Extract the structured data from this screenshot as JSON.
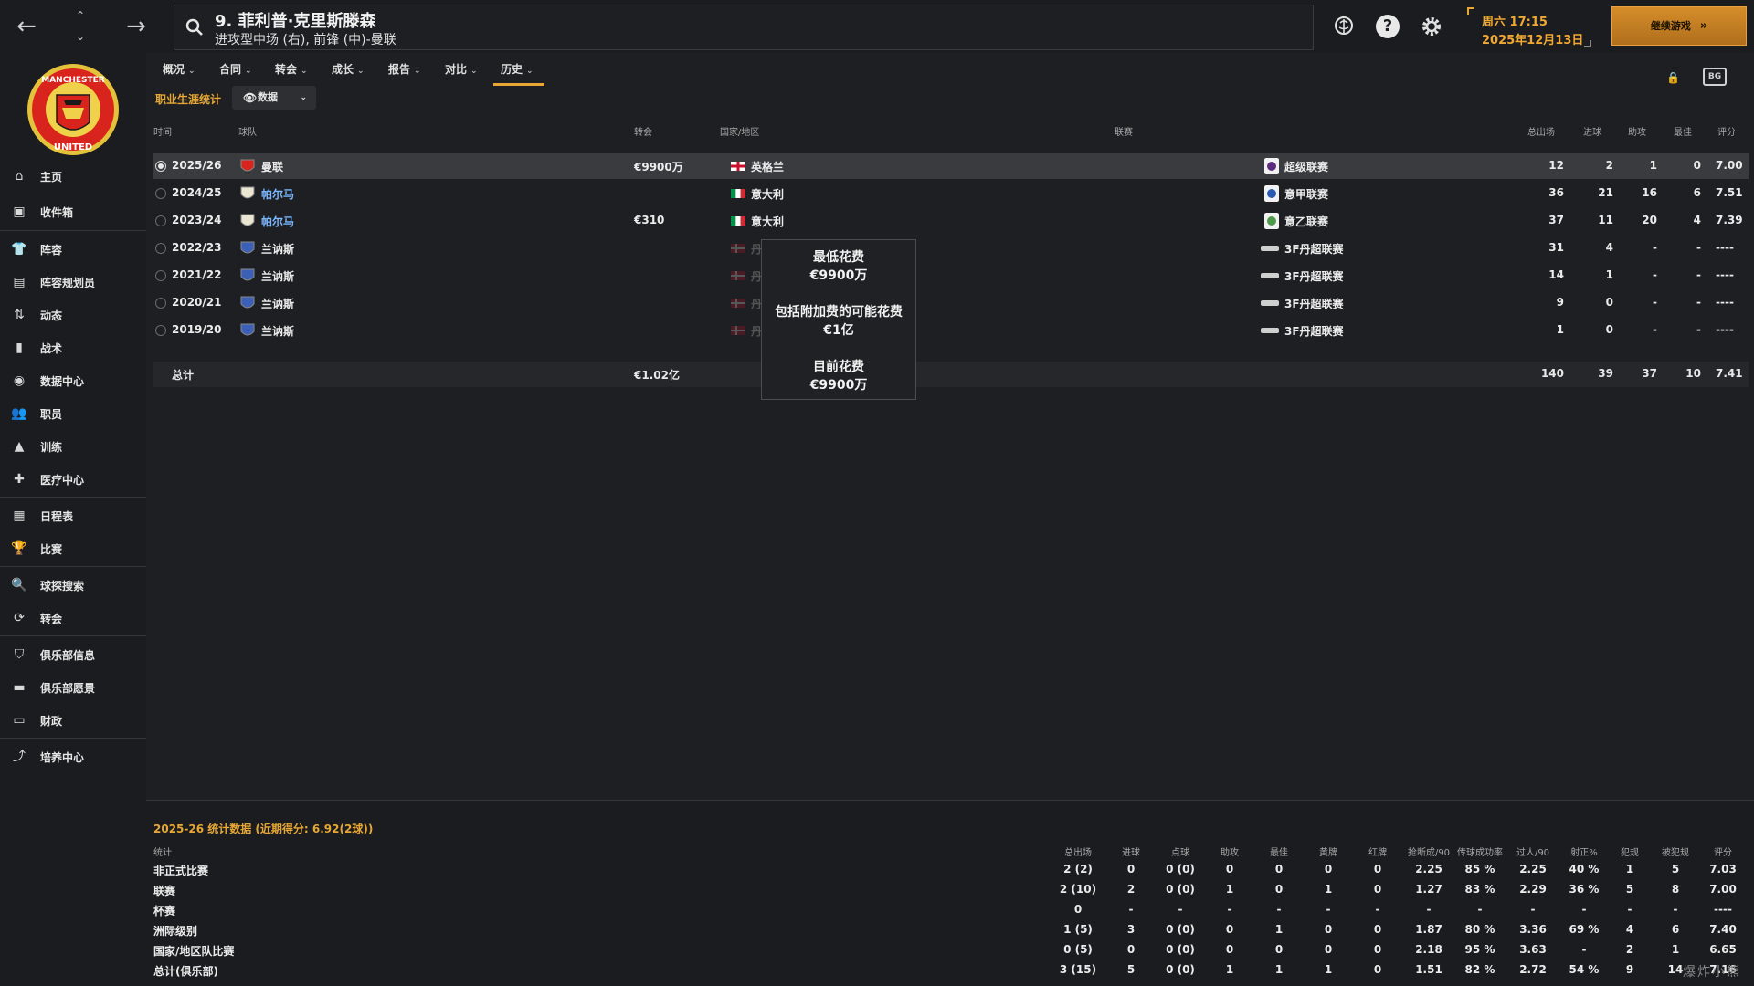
{
  "header": {
    "player_name": "9. 菲利普·克里斯滕森",
    "player_position": "进攻型中场 (右), 前锋 (中)-曼联",
    "day_time": "周六 17:15",
    "date": "2025年12月13日",
    "continue_label": "继续游戏",
    "bgm_icon_text": "BG"
  },
  "sidebar": {
    "items": [
      {
        "label": "主页",
        "icon": "home-icon"
      },
      {
        "label": "收件箱",
        "icon": "inbox-icon"
      },
      {
        "label": "阵容",
        "icon": "squad-icon"
      },
      {
        "label": "阵容规划员",
        "icon": "clipboard-icon"
      },
      {
        "label": "动态",
        "icon": "dynamics-icon"
      },
      {
        "label": "战术",
        "icon": "tactics-icon"
      },
      {
        "label": "数据中心",
        "icon": "data-hub-icon"
      },
      {
        "label": "职员",
        "icon": "staff-icon"
      },
      {
        "label": "训练",
        "icon": "training-icon"
      },
      {
        "label": "医疗中心",
        "icon": "medical-icon"
      },
      {
        "label": "日程表",
        "icon": "calendar-icon"
      },
      {
        "label": "比赛",
        "icon": "trophy-icon"
      },
      {
        "label": "球探搜索",
        "icon": "scout-search-icon"
      },
      {
        "label": "转会",
        "icon": "transfer-icon"
      },
      {
        "label": "俱乐部信息",
        "icon": "shield-icon"
      },
      {
        "label": "俱乐部愿景",
        "icon": "vision-icon"
      },
      {
        "label": "财政",
        "icon": "finance-icon"
      },
      {
        "label": "培养中心",
        "icon": "development-icon"
      }
    ]
  },
  "tabs": [
    {
      "label": "概况"
    },
    {
      "label": "合同"
    },
    {
      "label": "转会"
    },
    {
      "label": "成长"
    },
    {
      "label": "报告"
    },
    {
      "label": "对比"
    },
    {
      "label": "历史"
    }
  ],
  "career": {
    "title": "职业生涯统计",
    "view_dropdown": "数据",
    "columns": {
      "time": "时间",
      "team": "球队",
      "fee": "转会",
      "nation": "国家/地区",
      "league": "联赛",
      "apps": "总出场",
      "goals": "进球",
      "assists": "助攻",
      "pom": "最佳",
      "rating": "评分"
    },
    "rows": [
      {
        "season": "2025/26",
        "team": "曼联",
        "fee": "€9900万",
        "nation": "英格兰",
        "league": "超级联赛",
        "apps": "12",
        "goals": "2",
        "assists": "1",
        "pom": "0",
        "rating": "7.00"
      },
      {
        "season": "2024/25",
        "team": "帕尔马",
        "fee": "",
        "nation": "意大利",
        "league": "意甲联赛",
        "apps": "36",
        "goals": "21",
        "assists": "16",
        "pom": "6",
        "rating": "7.51"
      },
      {
        "season": "2023/24",
        "team": "帕尔马",
        "fee": "€310",
        "nation": "意大利",
        "league": "意乙联赛",
        "apps": "37",
        "goals": "11",
        "assists": "20",
        "pom": "4",
        "rating": "7.39"
      },
      {
        "season": "2022/23",
        "team": "兰讷斯",
        "fee": "",
        "nation": "丹麦",
        "league": "3F丹超联赛",
        "apps": "31",
        "goals": "4",
        "assists": "-",
        "pom": "-",
        "rating": "----"
      },
      {
        "season": "2021/22",
        "team": "兰讷斯",
        "fee": "",
        "nation": "丹麦",
        "league": "3F丹超联赛",
        "apps": "14",
        "goals": "1",
        "assists": "-",
        "pom": "-",
        "rating": "----"
      },
      {
        "season": "2020/21",
        "team": "兰讷斯",
        "fee": "",
        "nation": "丹麦",
        "league": "3F丹超联赛",
        "apps": "9",
        "goals": "0",
        "assists": "-",
        "pom": "-",
        "rating": "----"
      },
      {
        "season": "2019/20",
        "team": "兰讷斯",
        "fee": "",
        "nation": "丹麦",
        "league": "3F丹超联赛",
        "apps": "1",
        "goals": "0",
        "assists": "-",
        "pom": "-",
        "rating": "----"
      }
    ],
    "total": {
      "label": "总计",
      "fee": "€1.02亿",
      "apps": "140",
      "goals": "39",
      "assists": "37",
      "pom": "10",
      "rating": "7.41"
    }
  },
  "tooltip": {
    "min_label": "最低花费",
    "min_value": "€9900万",
    "addons_label": "包括附加费的可能花费",
    "addons_value": "€1亿",
    "current_label": "目前花费",
    "current_value": "€9900万"
  },
  "season_stats": {
    "title": "2025-26 统计数据 (近期得分: 6.92(2球))",
    "columns": [
      "统计",
      "总出场",
      "进球",
      "点球",
      "助攻",
      "最佳",
      "黄牌",
      "红牌",
      "抢断成/90",
      "传球成功率",
      "过人/90",
      "射正%",
      "犯规",
      "被犯规",
      "评分"
    ],
    "rows": [
      [
        "非正式比赛",
        "2 (2)",
        "0",
        "0 (0)",
        "0",
        "0",
        "0",
        "0",
        "2.25",
        "85 %",
        "2.25",
        "40 %",
        "1",
        "5",
        "7.03"
      ],
      [
        "联赛",
        "2 (10)",
        "2",
        "0 (0)",
        "1",
        "0",
        "1",
        "0",
        "1.27",
        "83 %",
        "2.29",
        "36 %",
        "5",
        "8",
        "7.00"
      ],
      [
        "杯赛",
        "0",
        "-",
        "-",
        "-",
        "-",
        "-",
        "-",
        "-",
        "-",
        "-",
        "-",
        "-",
        "-",
        "----"
      ],
      [
        "洲际级别",
        "1 (5)",
        "3",
        "0 (0)",
        "0",
        "1",
        "0",
        "0",
        "1.87",
        "80 %",
        "3.36",
        "69 %",
        "4",
        "6",
        "7.40"
      ],
      [
        "国家/地区队比赛",
        "0 (5)",
        "0",
        "0 (0)",
        "0",
        "0",
        "0",
        "0",
        "2.18",
        "95 %",
        "3.63",
        "-",
        "2",
        "1",
        "6.65"
      ],
      [
        "总计(俱乐部)",
        "3 (15)",
        "5",
        "0 (0)",
        "1",
        "1",
        "1",
        "0",
        "1.51",
        "82 %",
        "2.72",
        "54 %",
        "9",
        "14",
        "7.16"
      ]
    ]
  },
  "watermark": "爆炸 小熊",
  "colors": {
    "accent": "#e6a735",
    "link": "#7ab7ff",
    "selected_row": "#3a3b3f"
  }
}
